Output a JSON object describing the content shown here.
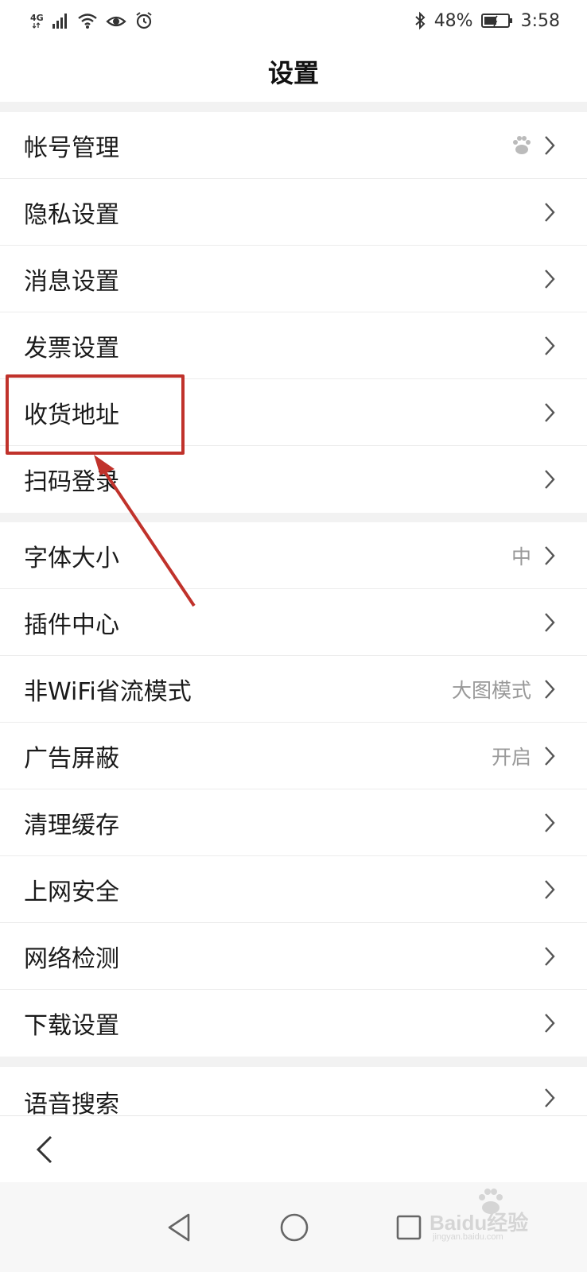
{
  "status_bar": {
    "network": "4G",
    "battery": "48%",
    "time": "3:58",
    "icons": [
      "signal-icon",
      "wifi-icon",
      "eye-icon",
      "alarm-icon",
      "bluetooth-icon",
      "battery-icon"
    ]
  },
  "header": {
    "title": "设置"
  },
  "groups": [
    {
      "items": [
        {
          "label": "帐号管理",
          "value": "",
          "icon": "baidu-paw-icon"
        },
        {
          "label": "隐私设置",
          "value": ""
        },
        {
          "label": "消息设置",
          "value": ""
        },
        {
          "label": "发票设置",
          "value": ""
        },
        {
          "label": "收货地址",
          "value": ""
        },
        {
          "label": "扫码登录",
          "value": ""
        }
      ]
    },
    {
      "items": [
        {
          "label": "字体大小",
          "value": "中"
        },
        {
          "label": "插件中心",
          "value": ""
        },
        {
          "label": "非WiFi省流模式",
          "value": "大图模式"
        },
        {
          "label": "广告屏蔽",
          "value": "开启"
        },
        {
          "label": "清理缓存",
          "value": ""
        },
        {
          "label": "上网安全",
          "value": ""
        },
        {
          "label": "网络检测",
          "value": ""
        },
        {
          "label": "下载设置",
          "value": ""
        }
      ]
    },
    {
      "items": [
        {
          "label": "语音搜索",
          "value": ""
        }
      ]
    }
  ],
  "annotation": {
    "highlight_color": "#c0322b"
  },
  "watermark": {
    "text": "Baidu经验",
    "sub": "jingyan.baidu.com"
  }
}
